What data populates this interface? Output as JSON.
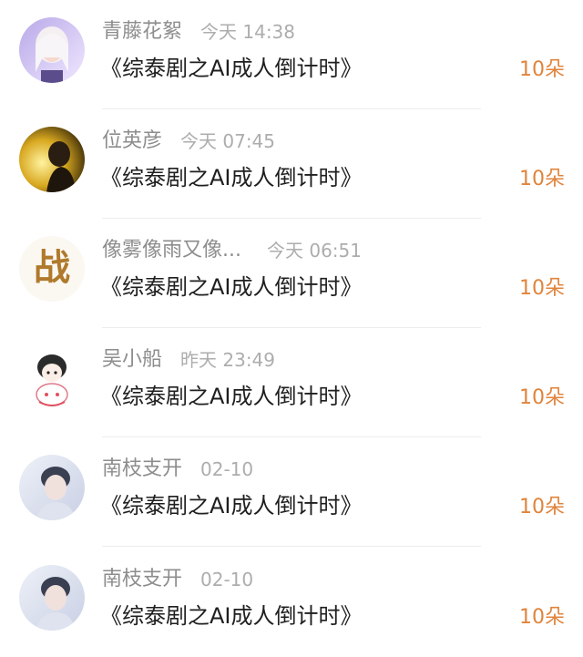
{
  "comments": [
    {
      "name": "青藤花絮",
      "time": "今天 14:38",
      "title": "《综泰剧之AI成人倒计时》",
      "reward": "10朵",
      "avatar": "avatar-white-hair-girl"
    },
    {
      "name": "位英彦",
      "time": "今天 07:45",
      "title": "《综泰剧之AI成人倒计时》",
      "reward": "10朵",
      "avatar": "avatar-golden-light-boy"
    },
    {
      "name": "像雾像雨又像...",
      "time": "今天 06:51",
      "title": "《综泰剧之AI成人倒计时》",
      "reward": "10朵",
      "avatar": "avatar-calligraphy"
    },
    {
      "name": "吴小船",
      "time": "昨天 23:49",
      "title": "《综泰剧之AI成人倒计时》",
      "reward": "10朵",
      "avatar": "avatar-cartoon-girl"
    },
    {
      "name": "南枝支开",
      "time": "02-10",
      "title": "《综泰剧之AI成人倒计时》",
      "reward": "10朵",
      "avatar": "avatar-portrait-boy"
    },
    {
      "name": "南枝支开",
      "time": "02-10",
      "title": "《综泰剧之AI成人倒计时》",
      "reward": "10朵",
      "avatar": "avatar-portrait-boy"
    }
  ],
  "avatar_calligraphy_text": "战",
  "colors": {
    "name": "#8d8d8d",
    "time": "#adadad",
    "title": "#1f1f1f",
    "reward": "#e0843c",
    "divider": "#ededed"
  }
}
